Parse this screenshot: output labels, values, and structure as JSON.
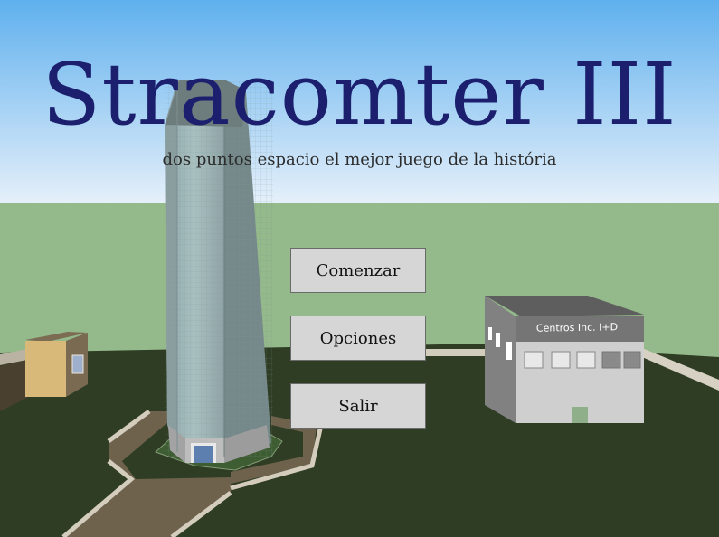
{
  "title": "Stracomter III",
  "subtitle": "dos puntos espacio el mejor juego de la história",
  "menu": {
    "start_label": "Comenzar",
    "options_label": "Opciones",
    "exit_label": "Salir"
  },
  "scene": {
    "building_sign": "Centros Inc. I+D",
    "colors": {
      "sky_top": "#5fb0ee",
      "sky_bottom": "#e6f0fa",
      "grass": "#94b98a",
      "ground": "#2f3d24",
      "title": "#1b1f6e"
    }
  }
}
